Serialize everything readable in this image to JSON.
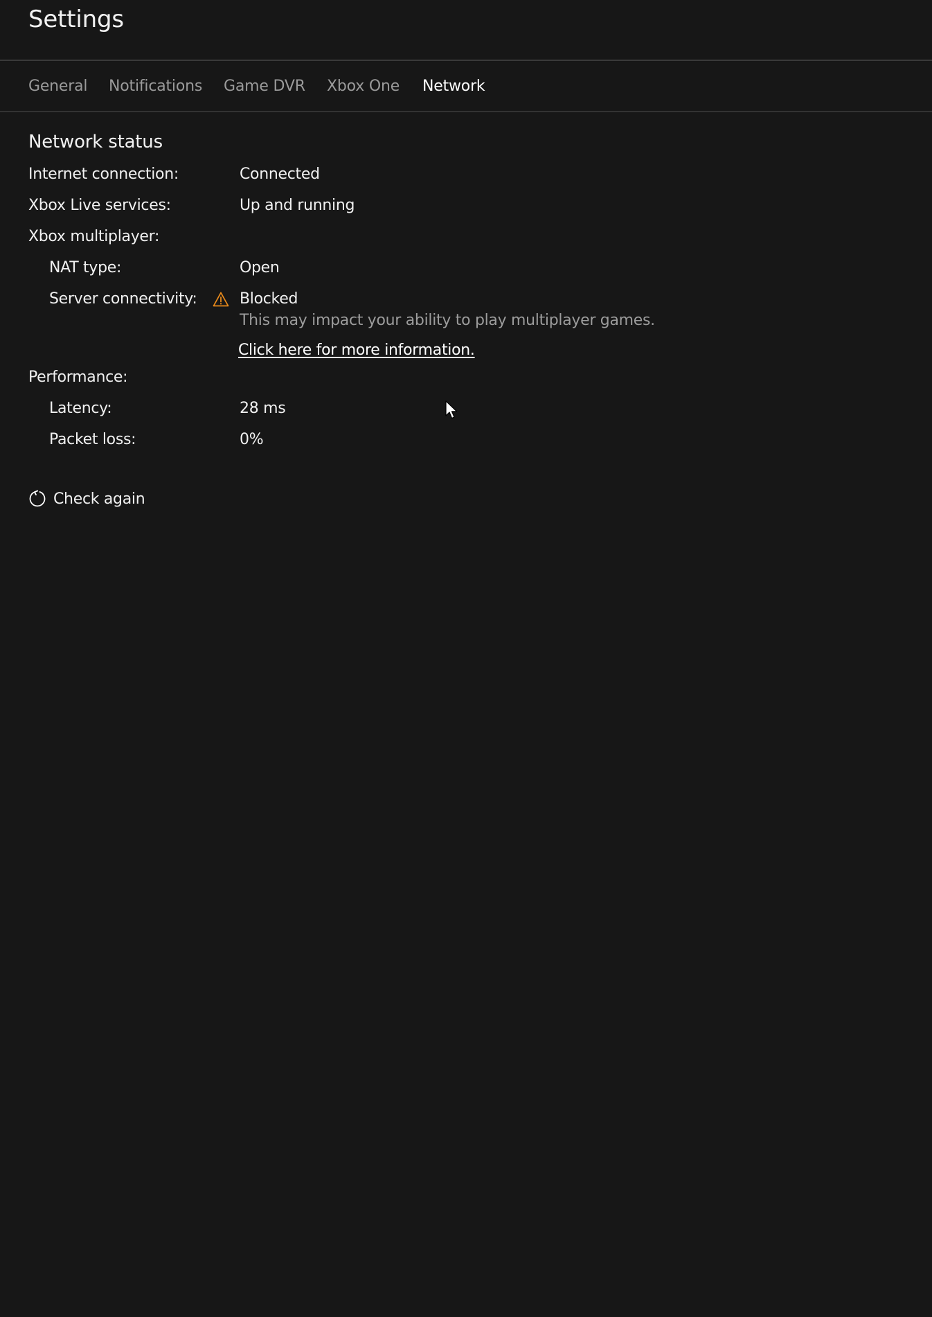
{
  "header": {
    "title": "Settings"
  },
  "tabs": [
    {
      "label": "General",
      "active": false
    },
    {
      "label": "Notifications",
      "active": false
    },
    {
      "label": "Game DVR",
      "active": false
    },
    {
      "label": "Xbox One",
      "active": false
    },
    {
      "label": "Network",
      "active": true
    }
  ],
  "network": {
    "section_title": "Network status",
    "internet_label": "Internet connection:",
    "internet_value": "Connected",
    "live_label": "Xbox Live services:",
    "live_value": "Up and running",
    "multiplayer_label": "Xbox multiplayer:",
    "nat_label": "NAT type:",
    "nat_value": "Open",
    "server_label": "Server connectivity:",
    "server_value": "Blocked",
    "server_warning_icon": "warning-triangle-icon",
    "server_note": "This may impact your ability to play multiplayer games.",
    "info_link": "Click here for more information.",
    "performance_label": "Performance:",
    "latency_label": "Latency:",
    "latency_value": "28 ms",
    "packet_loss_label": "Packet loss:",
    "packet_loss_value": "0%",
    "check_again_label": "Check again",
    "check_again_icon": "refresh-icon"
  },
  "colors": {
    "background": "#171717",
    "warning": "#e8891a",
    "text": "#ffffff",
    "muted": "#9a9a9a"
  }
}
